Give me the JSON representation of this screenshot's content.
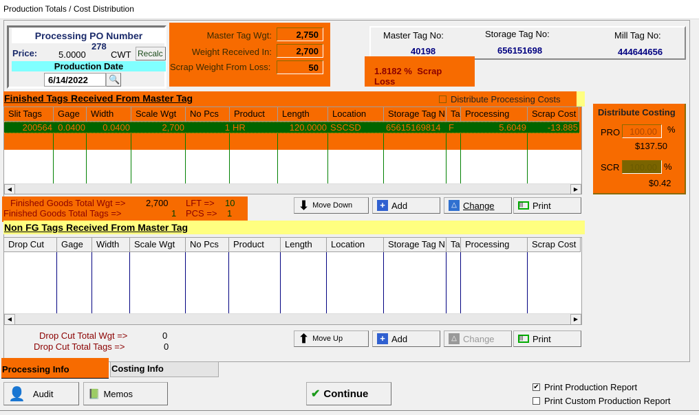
{
  "window": {
    "title": "Production Totals / Cost Distribution"
  },
  "po": {
    "label": "Processing PO Number",
    "number": "278",
    "price_label": "Price:",
    "price": "5.0000",
    "unit": "CWT",
    "recalc": "Recalc",
    "date_label": "Production Date",
    "date": "6/14/2022"
  },
  "weights": {
    "master_label": "Master Tag Wgt:",
    "master": "2,750",
    "received_label": "Weight Received In:",
    "received": "2,700",
    "scrap_label": "Scrap Weight From Loss:",
    "scrap": "50"
  },
  "tags": {
    "master_label": "Master Tag No:",
    "master": "40198",
    "storage_label": "Storage Tag No:",
    "storage": "656151698",
    "mill_label": "Mill Tag No:",
    "mill": "444644656"
  },
  "scrap_loss": {
    "percent": "1.8182",
    "pct_sign": "%",
    "label": "Scrap Loss"
  },
  "finished": {
    "title": "Finished Tags Received From Master Tag",
    "distribute_label": "Distribute Processing Costs",
    "distribute_checked": false,
    "columns": [
      "Slit Tags",
      "Gage",
      "Width",
      "Scale Wgt",
      "No Pcs",
      "Product",
      "Length",
      "Location",
      "Storage Tag N",
      "Tag",
      "Processing",
      "Scrap Cost"
    ],
    "rows": [
      [
        "200564",
        "0.0400",
        "0.0400",
        "2,700",
        "1",
        "HR",
        "120.0000",
        "SSCSD",
        "65615169814",
        "F",
        "5.6049",
        "-13.885"
      ]
    ],
    "total_wgt_label": "Finished Goods Total Wgt =>",
    "total_wgt": "2,700",
    "lft_label": "LFT =>",
    "lft": "10",
    "total_tags_label": "Finished Goods Total Tags =>",
    "total_tags": "1",
    "pcs_label": "PCS =>",
    "pcs": "1"
  },
  "costing": {
    "title": "Distribute Costing",
    "pro_label": "PRO",
    "pro": "100.00",
    "pro_amount": "$137.50",
    "scr_label": "SCR",
    "scr": "100.00",
    "scr_amount": "$0.42",
    "pct": "%"
  },
  "nonfg": {
    "title": "Non FG Tags Received From Master Tag",
    "columns": [
      "Drop Cut",
      "Gage",
      "Width",
      "Scale Wgt",
      "No Pcs",
      "Product",
      "Length",
      "Location",
      "Storage Tag N",
      "Tag",
      "Processing",
      "Scrap Cost"
    ],
    "total_wgt_label": "Drop Cut Total Wgt =>",
    "total_wgt": "0",
    "total_tags_label": "Drop Cut Total Tags =>",
    "total_tags": "0"
  },
  "buttons": {
    "move_down": "Move Down",
    "move_up": "Move Up",
    "add": "Add",
    "change": "Change",
    "change_nonfg_enabled": false,
    "print": "Print",
    "audit": "Audit",
    "memos": "Memos",
    "continue": "Continue"
  },
  "tabs": [
    "Processing Info",
    "Costing Info"
  ],
  "options": {
    "print_production": "Print Production Report",
    "print_production_checked": true,
    "print_custom": "Print Custom Production Report",
    "print_custom_checked": false
  },
  "colors": {
    "accent": "#f76b00",
    "selected_row": "#006400",
    "header_yellow": "#ffff80",
    "date_cyan": "#80ffff"
  }
}
